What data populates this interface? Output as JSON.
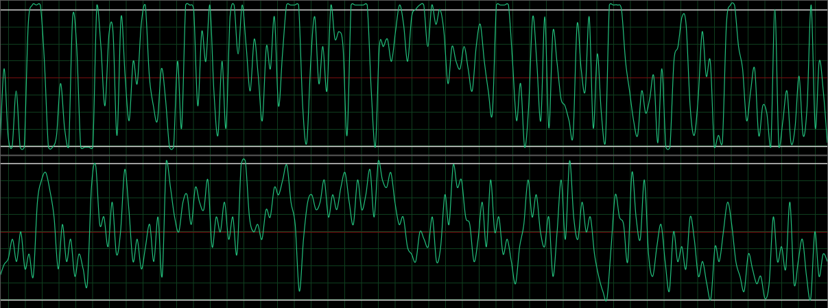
{
  "window": {
    "title": ""
  },
  "colors": {
    "background": "#000000",
    "grid": "#0f3f1f",
    "center_line": "#7a1010",
    "limit_line": "#d8d8d8",
    "trace": "#22c27e",
    "frame": "#5a5a5a"
  },
  "channels": [
    {
      "name": "",
      "clipped": true,
      "samples": [
        0.02,
        0.55,
        0.1,
        0.02,
        0.4,
        0.02,
        0.02,
        0.85,
        0.98,
        0.98,
        0.98,
        0.6,
        0.02,
        0.02,
        0.1,
        0.45,
        0.15,
        0.02,
        0.9,
        0.7,
        0.02,
        0.02,
        0.02,
        0.02,
        0.98,
        0.7,
        0.3,
        0.78,
        0.8,
        0.1,
        0.9,
        0.5,
        0.2,
        0.6,
        0.45,
        0.85,
        0.98,
        0.5,
        0.3,
        0.2,
        0.55,
        0.35,
        0.02,
        0.02,
        0.6,
        0.15,
        0.98,
        0.98,
        0.95,
        0.3,
        0.8,
        0.6,
        0.98,
        0.4,
        0.1,
        0.6,
        0.15,
        0.9,
        0.98,
        0.65,
        0.98,
        0.7,
        0.4,
        0.75,
        0.5,
        0.2,
        0.7,
        0.55,
        0.9,
        0.3,
        0.65,
        0.98,
        0.98,
        0.98,
        0.98,
        0.3,
        0.05,
        0.6,
        0.9,
        0.45,
        0.7,
        0.4,
        0.98,
        0.75,
        0.8,
        0.7,
        0.1,
        0.98,
        0.98,
        0.98,
        0.98,
        0.98,
        0.4,
        0.02,
        0.7,
        0.7,
        0.75,
        0.6,
        0.8,
        0.98,
        0.85,
        0.6,
        0.9,
        0.95,
        0.98,
        0.98,
        0.7,
        0.98,
        0.85,
        0.95,
        0.8,
        0.45,
        0.7,
        0.6,
        0.55,
        0.7,
        0.55,
        0.4,
        0.7,
        0.85,
        0.6,
        0.4,
        0.25,
        0.98,
        0.98,
        0.98,
        0.98,
        0.6,
        0.2,
        0.45,
        0.02,
        0.3,
        0.9,
        0.6,
        0.2,
        0.9,
        0.15,
        0.8,
        0.6,
        0.35,
        0.3,
        0.2,
        0.1,
        0.85,
        0.55,
        0.4,
        0.9,
        0.15,
        0.65,
        0.25,
        0.05,
        0.98,
        0.98,
        0.98,
        0.95,
        0.6,
        0.4,
        0.2,
        0.1,
        0.4,
        0.25,
        0.35,
        0.5,
        0.05,
        0.55,
        0.02,
        0.02,
        0.6,
        0.7,
        0.9,
        0.85,
        0.3,
        0.1,
        0.35,
        0.8,
        0.5,
        0.6,
        0.02,
        0.1,
        0.05,
        0.85,
        0.98,
        0.98,
        0.7,
        0.55,
        0.2,
        0.4,
        0.55,
        0.1,
        0.3,
        0.25,
        0.02,
        0.95,
        0.02,
        0.2,
        0.4,
        0.05,
        0.15,
        0.5,
        0.1,
        0.3,
        0.98,
        0.15,
        0.6,
        0.4,
        0.05
      ]
    },
    {
      "name": "",
      "clipped": false,
      "samples": [
        0.2,
        0.28,
        0.32,
        0.45,
        0.3,
        0.5,
        0.25,
        0.35,
        0.2,
        0.7,
        0.85,
        0.9,
        0.78,
        0.6,
        0.25,
        0.55,
        0.3,
        0.45,
        0.2,
        0.35,
        0.25,
        0.15,
        0.8,
        0.95,
        0.55,
        0.6,
        0.4,
        0.7,
        0.35,
        0.5,
        0.92,
        0.65,
        0.3,
        0.45,
        0.25,
        0.4,
        0.55,
        0.3,
        0.6,
        0.2,
        0.98,
        0.8,
        0.6,
        0.5,
        0.7,
        0.75,
        0.55,
        0.8,
        0.7,
        0.65,
        0.85,
        0.4,
        0.6,
        0.5,
        0.7,
        0.45,
        0.6,
        0.35,
        0.95,
        0.98,
        0.6,
        0.5,
        0.55,
        0.45,
        0.65,
        0.6,
        0.8,
        0.75,
        0.85,
        0.95,
        0.7,
        0.55,
        0.1,
        0.45,
        0.7,
        0.75,
        0.65,
        0.7,
        0.85,
        0.6,
        0.75,
        0.65,
        0.8,
        0.9,
        0.7,
        0.55,
        0.85,
        0.65,
        0.75,
        0.92,
        0.6,
        0.98,
        0.85,
        0.8,
        0.9,
        0.7,
        0.55,
        0.6,
        0.4,
        0.35,
        0.3,
        0.5,
        0.45,
        0.4,
        0.6,
        0.3,
        0.4,
        0.75,
        0.55,
        0.95,
        0.8,
        0.85,
        0.6,
        0.55,
        0.3,
        0.45,
        0.7,
        0.4,
        0.85,
        0.5,
        0.6,
        0.35,
        0.45,
        0.3,
        0.15,
        0.4,
        0.55,
        0.85,
        0.6,
        0.75,
        0.5,
        0.4,
        0.6,
        0.2,
        0.5,
        0.85,
        0.45,
        0.98,
        0.6,
        0.45,
        0.7,
        0.5,
        0.6,
        0.35,
        0.2,
        0.1,
        0.05,
        0.4,
        0.75,
        0.6,
        0.55,
        0.3,
        0.9,
        0.6,
        0.45,
        0.85,
        0.35,
        0.2,
        0.4,
        0.55,
        0.3,
        0.1,
        0.5,
        0.3,
        0.4,
        0.25,
        0.6,
        0.45,
        0.2,
        0.3,
        0.15,
        0.05,
        0.4,
        0.3,
        0.5,
        0.7,
        0.55,
        0.3,
        0.2,
        0.1,
        0.35,
        0.25,
        0.15,
        0.2,
        0.05,
        0.15,
        0.6,
        0.3,
        0.4,
        0.25,
        0.7,
        0.15,
        0.3,
        0.45,
        0.2,
        0.05,
        0.5,
        0.2,
        0.35,
        0.3
      ]
    }
  ]
}
